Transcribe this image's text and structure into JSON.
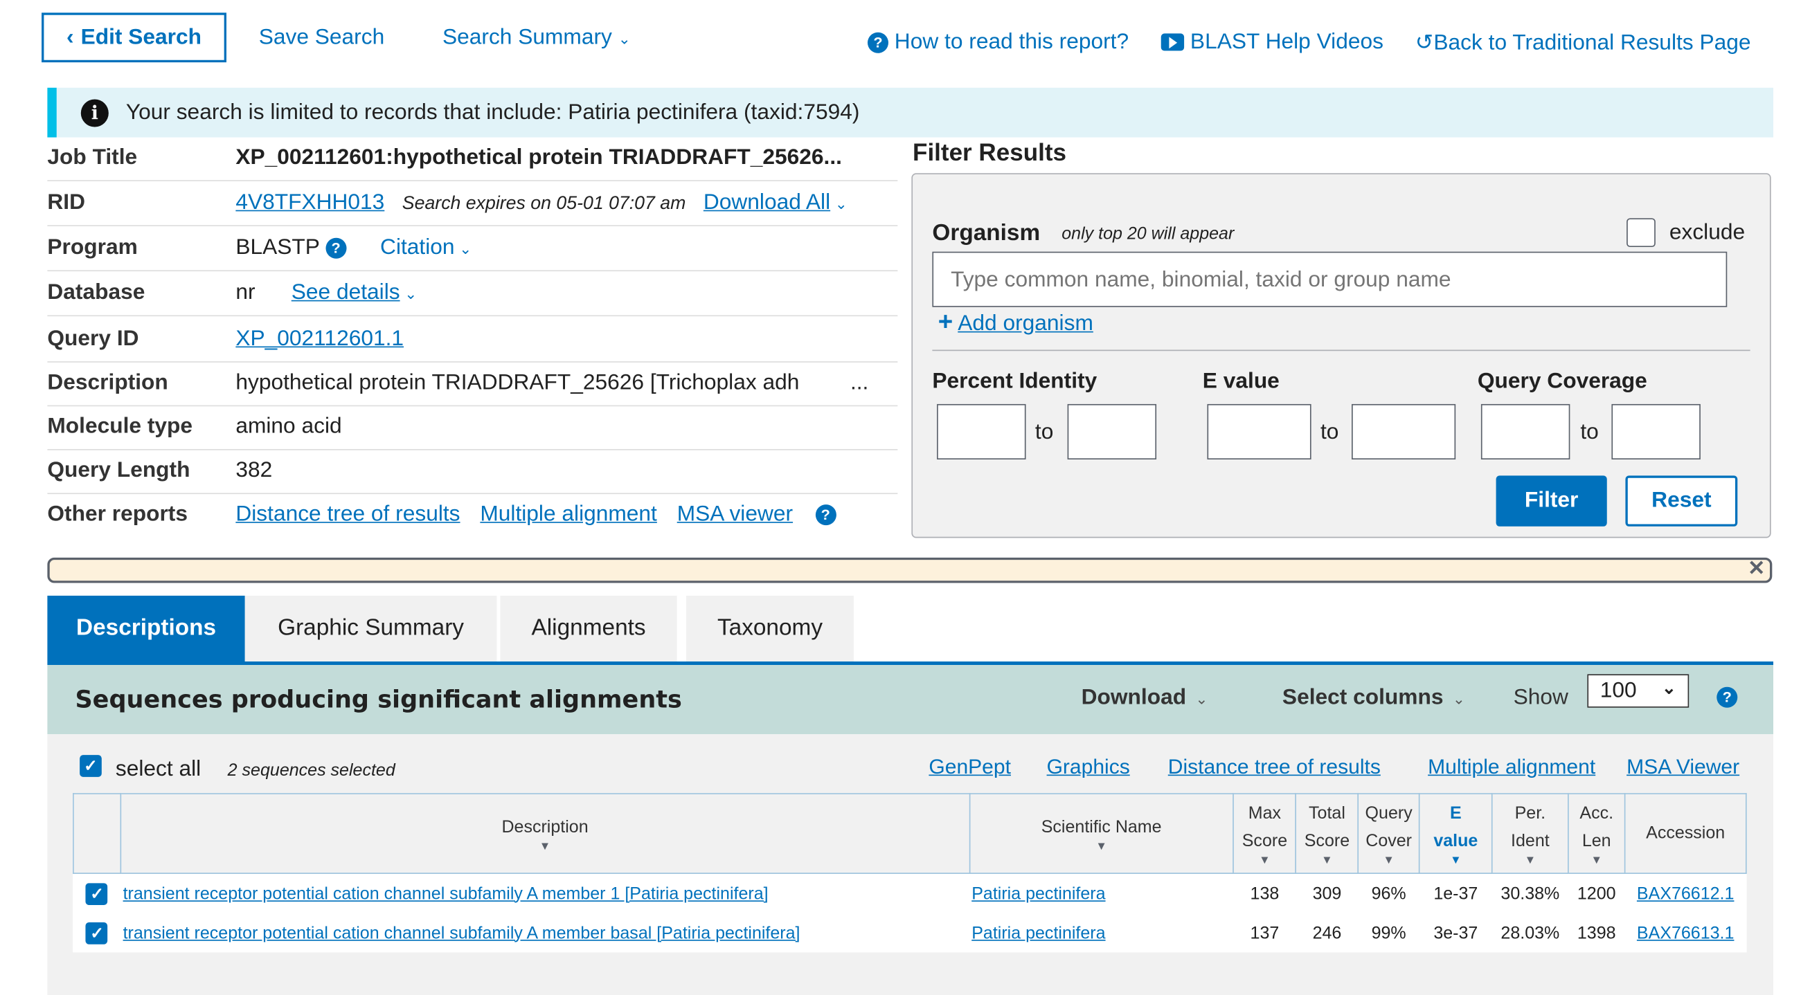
{
  "toolbar": {
    "edit_search": "Edit Search",
    "save_search": "Save Search",
    "search_summary": "Search Summary",
    "how_to_read": "How to read this report?",
    "help_videos": "BLAST Help Videos",
    "back_traditional": "Back to Traditional Results Page"
  },
  "info_banner": "Your search is limited to records that include: Patiria pectinifera (taxid:7594)",
  "job": {
    "job_title_label": "Job Title",
    "job_title": "XP_002112601:hypothetical protein TRIADDRAFT_25626...",
    "rid_label": "RID",
    "rid": "4V8TFXHH013",
    "expires": "Search expires on 05-01 07:07 am",
    "download_all": "Download All",
    "program_label": "Program",
    "program": "BLASTP",
    "citation": "Citation",
    "database_label": "Database",
    "database": "nr",
    "see_details": "See details",
    "query_id_label": "Query ID",
    "query_id": "XP_002112601.1",
    "description_label": "Description",
    "description": "hypothetical protein TRIADDRAFT_25626 [Trichoplax adh",
    "ellipsis": "...",
    "molecule_type_label": "Molecule type",
    "molecule_type": "amino acid",
    "query_length_label": "Query Length",
    "query_length": "382",
    "other_reports_label": "Other reports",
    "distance_tree": "Distance tree of results",
    "multiple_alignment": "Multiple alignment",
    "msa_viewer": "MSA viewer"
  },
  "filter": {
    "title": "Filter Results",
    "organism_label": "Organism",
    "organism_note": "only top 20 will appear",
    "exclude_label": "exclude",
    "organism_placeholder": "Type common  name, binomial, taxid or group  name",
    "add_organism": "Add organism",
    "percent_identity": "Percent Identity",
    "e_value": "E value",
    "query_coverage": "Query Coverage",
    "to": "to",
    "filter_button": "Filter",
    "reset_button": "Reset"
  },
  "tabs": [
    "Descriptions",
    "Graphic Summary",
    "Alignments",
    "Taxonomy"
  ],
  "results": {
    "title": "Sequences producing significant alignments",
    "download": "Download",
    "select_columns": "Select columns",
    "show_label": "Show",
    "show_value": "100",
    "select_all": "select all",
    "selected_note": "2 sequences selected",
    "links": [
      "GenPept",
      "Graphics",
      "Distance tree of results",
      "Multiple alignment",
      "MSA Viewer"
    ],
    "columns": {
      "description": "Description",
      "scientific_name": "Scientific Name",
      "max_score_1": "Max",
      "max_score_2": "Score",
      "total_score_1": "Total",
      "total_score_2": "Score",
      "query_cover_1": "Query",
      "query_cover_2": "Cover",
      "e_value_1": "E",
      "e_value_2": "value",
      "per_ident_1": "Per.",
      "per_ident_2": "Ident",
      "acc_len_1": "Acc.",
      "acc_len_2": "Len",
      "accession": "Accession"
    },
    "rows": [
      {
        "description": "transient receptor potential cation channel subfamily A member 1 [Patiria pectinifera]",
        "scientific_name": "Patiria pectinifera",
        "max_score": "138",
        "total_score": "309",
        "query_cover": "96%",
        "e_value": "1e-37",
        "per_ident": "30.38%",
        "acc_len": "1200",
        "accession": "BAX76612.1"
      },
      {
        "description": "transient receptor potential cation channel subfamily A member basal [Patiria pectinifera]",
        "scientific_name": "Patiria pectinifera",
        "max_score": "137",
        "total_score": "246",
        "query_cover": "99%",
        "e_value": "3e-37",
        "per_ident": "28.03%",
        "acc_len": "1398",
        "accession": "BAX76613.1"
      }
    ]
  }
}
